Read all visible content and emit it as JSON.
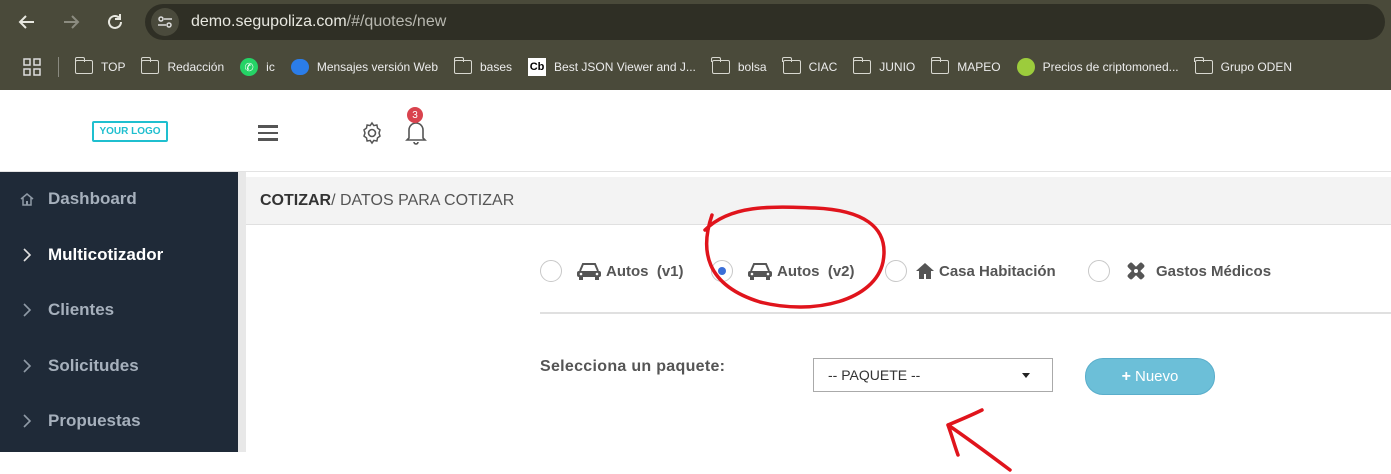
{
  "browser": {
    "url_host": "demo.segupoliza.com",
    "url_path": "/#/quotes/new",
    "bookmarks": [
      {
        "label": "TOP",
        "icon": "folder"
      },
      {
        "label": "Redacción",
        "icon": "folder"
      },
      {
        "label": "ic",
        "icon": "whatsapp"
      },
      {
        "label": "Mensajes versión Web",
        "icon": "messages"
      },
      {
        "label": "bases",
        "icon": "folder"
      },
      {
        "label": "Best JSON Viewer and J...",
        "icon": "cb"
      },
      {
        "label": "bolsa",
        "icon": "folder"
      },
      {
        "label": "CIAC",
        "icon": "folder"
      },
      {
        "label": "JUNIO",
        "icon": "folder"
      },
      {
        "label": "MAPEO",
        "icon": "folder"
      },
      {
        "label": "Precios de criptomoned...",
        "icon": "coin"
      },
      {
        "label": "Grupo ODEN",
        "icon": "folder"
      }
    ]
  },
  "header": {
    "logo_text": "YOUR LOGO",
    "notification_count": "3"
  },
  "sidebar": {
    "items": [
      {
        "label": "Dashboard",
        "icon": "home-icon"
      },
      {
        "label": "Multicotizador",
        "icon": "chevron-right-icon"
      },
      {
        "label": "Clientes",
        "icon": "chevron-right-icon"
      },
      {
        "label": "Solicitudes",
        "icon": "chevron-right-icon"
      },
      {
        "label": "Propuestas",
        "icon": "chevron-right-icon"
      }
    ]
  },
  "main": {
    "breadcrumb_bold": "COTIZAR",
    "breadcrumb_rest": " / DATOS PARA COTIZAR",
    "options": [
      {
        "label": "Autos  (v1)",
        "icon": "car-icon",
        "checked": false
      },
      {
        "label": "Autos  (v2)",
        "icon": "car-icon",
        "checked": true
      },
      {
        "label": "Casa Habitación",
        "icon": "home-icon",
        "checked": false
      },
      {
        "label": "Gastos Médicos",
        "icon": "medical-icon",
        "checked": false
      }
    ],
    "package_label": "Selecciona un paquete:",
    "package_select": "-- PAQUETE --",
    "new_button": "Nuevo",
    "new_button_plus": "+"
  },
  "colors": {
    "accent": "#6cbfd8",
    "sidebar_bg": "#1f2a38",
    "logo": "#1fbfcf",
    "badge": "#d9434e",
    "annotation": "#e0141c"
  }
}
